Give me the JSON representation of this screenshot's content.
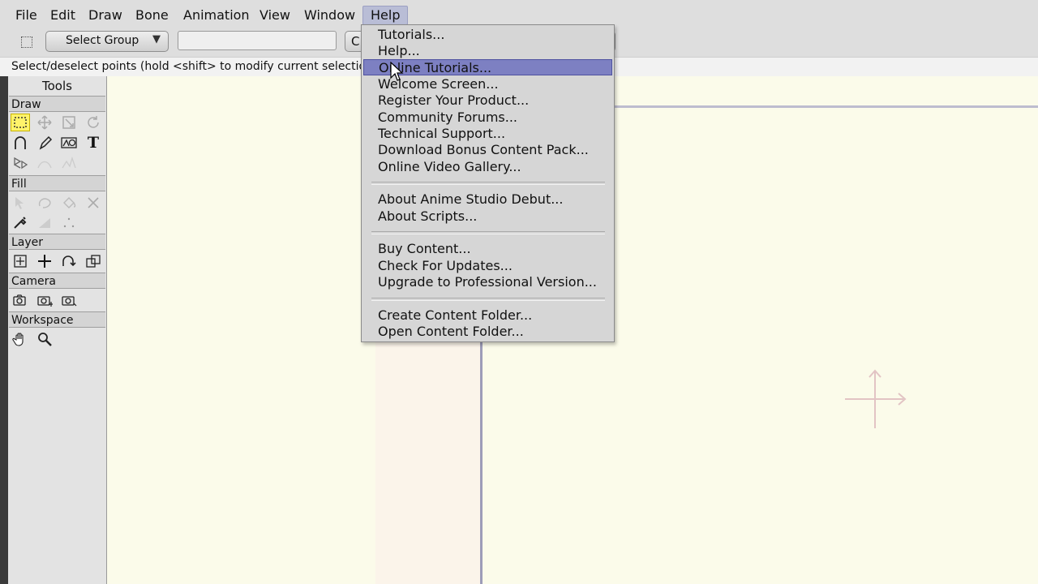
{
  "menubar": {
    "items": [
      "File",
      "Edit",
      "Draw",
      "Bone",
      "Animation",
      "View",
      "Window",
      "Help"
    ],
    "active": "Help"
  },
  "toolbar": {
    "select_group": "Select Group",
    "truncated_button": "C"
  },
  "status": {
    "text": "Select/deselect points (hold <shift> to modify current selection, <"
  },
  "tools_panel": {
    "title": "Tools",
    "sections": {
      "draw": "Draw",
      "fill": "Fill",
      "layer": "Layer",
      "camera": "Camera",
      "workspace": "Workspace"
    }
  },
  "help_menu": {
    "group1": [
      "Tutorials...",
      "Help...",
      "Online Tutorials...",
      "Welcome Screen...",
      "Register Your Product...",
      "Community Forums...",
      "Technical Support...",
      "Download Bonus Content Pack...",
      "Online Video Gallery..."
    ],
    "group2": [
      "About Anime Studio Debut...",
      "About Scripts..."
    ],
    "group3": [
      "Buy Content...",
      "Check For Updates...",
      "Upgrade to Professional Version..."
    ],
    "group4": [
      "Create Content Folder...",
      "Open Content Folder..."
    ],
    "highlighted": "Online Tutorials..."
  },
  "colors": {
    "canvas_bg": "#fbfbea",
    "menu_highlight": "#7d80c2",
    "selected_tool": "#fff36a"
  }
}
